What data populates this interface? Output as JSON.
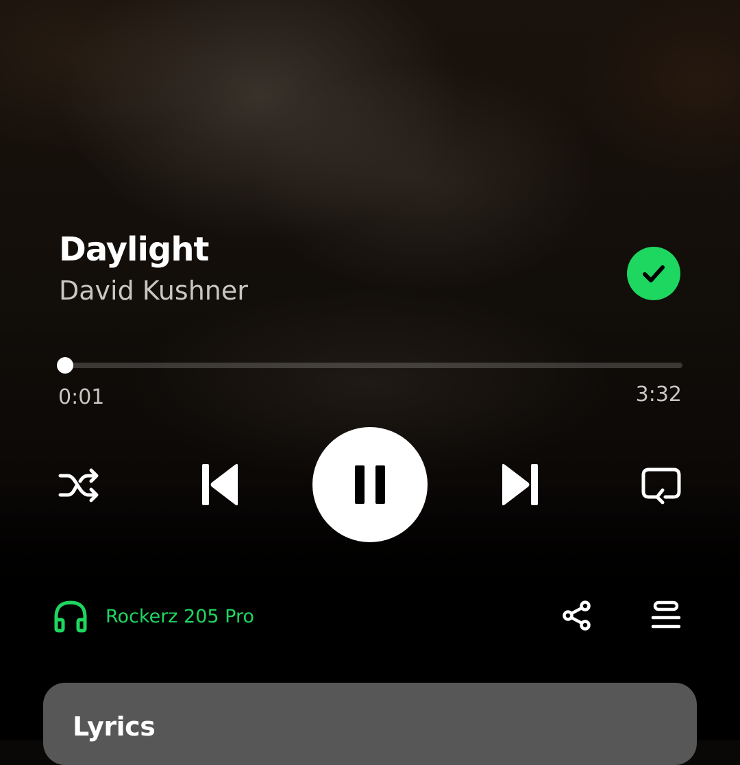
{
  "track": {
    "title": "Daylight",
    "artist": "David Kushner",
    "liked": true
  },
  "progress": {
    "current_time": "0:01",
    "total_time": "3:32",
    "fraction": 0.005
  },
  "controls": {
    "shuffle_icon": "shuffle-icon",
    "previous_icon": "skip-previous-icon",
    "play_pause_icon": "pause-icon",
    "next_icon": "skip-next-icon",
    "repeat_icon": "repeat-icon"
  },
  "device": {
    "name": "Rockerz 205 Pro",
    "icon": "headphones-icon"
  },
  "actions": {
    "share_icon": "share-icon",
    "queue_icon": "queue-icon"
  },
  "lyrics": {
    "title": "Lyrics"
  },
  "colors": {
    "accent": "#1ed760",
    "lyrics_card": "#575757",
    "secondary_text": "#c9c6c2"
  }
}
